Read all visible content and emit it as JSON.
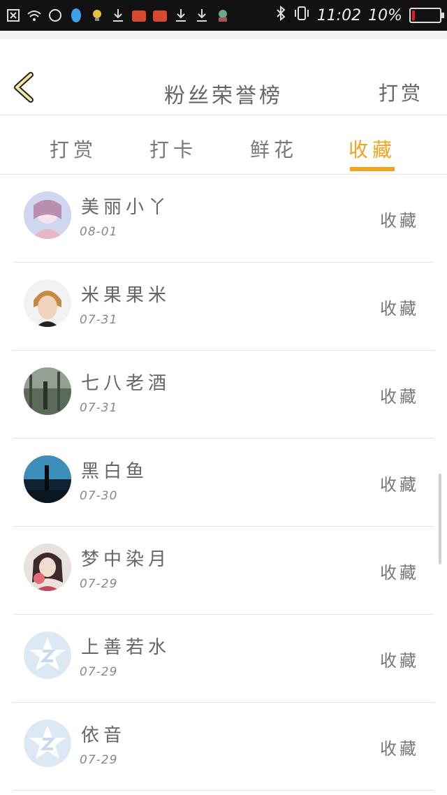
{
  "status_bar": {
    "time": "11:02",
    "battery": "10%"
  },
  "header": {
    "title": "粉丝荣誉榜",
    "right_action": "打赏",
    "back_icon": "chevron-left-icon"
  },
  "tabs": [
    {
      "label": "打赏",
      "active": false
    },
    {
      "label": "打卡",
      "active": false
    },
    {
      "label": "鲜花",
      "active": false
    },
    {
      "label": "收藏",
      "active": true
    }
  ],
  "list": [
    {
      "name": "美丽小丫",
      "date": "08-01",
      "action": "收藏"
    },
    {
      "name": "米果果米",
      "date": "07-31",
      "action": "收藏"
    },
    {
      "name": "七八老酒",
      "date": "07-31",
      "action": "收藏"
    },
    {
      "name": "黑白鱼",
      "date": "07-30",
      "action": "收藏"
    },
    {
      "name": "梦中染月",
      "date": "07-29",
      "action": "收藏"
    },
    {
      "name": "上善若水",
      "date": "07-29",
      "action": "收藏"
    },
    {
      "name": "依音",
      "date": "07-29",
      "action": "收藏"
    }
  ],
  "colors": {
    "accent": "#f4a21a",
    "back_icon_fill": "#f8e7a0",
    "back_icon_stroke": "#222222"
  }
}
